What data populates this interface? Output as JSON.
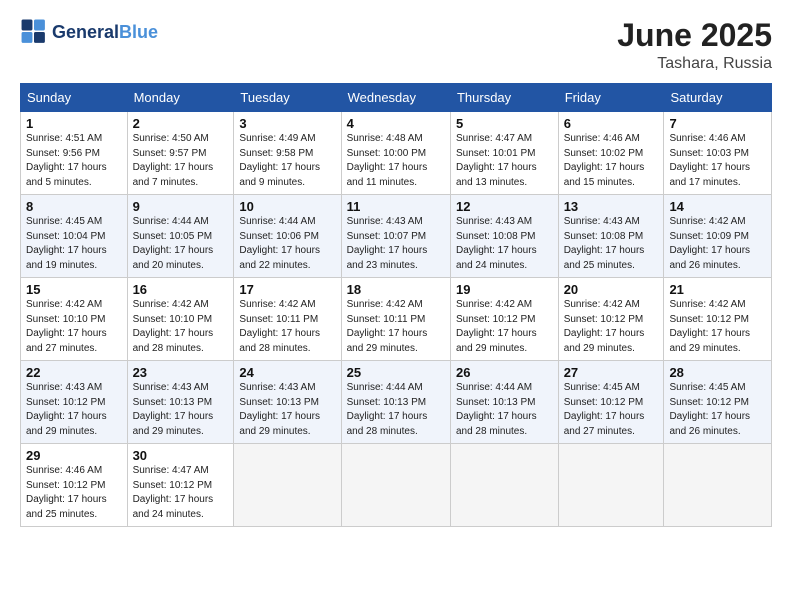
{
  "logo": {
    "text_general": "General",
    "text_blue": "Blue"
  },
  "title": "June 2025",
  "subtitle": "Tashara, Russia",
  "days_of_week": [
    "Sunday",
    "Monday",
    "Tuesday",
    "Wednesday",
    "Thursday",
    "Friday",
    "Saturday"
  ],
  "weeks": [
    [
      {
        "day": 1,
        "info": "Sunrise: 4:51 AM\nSunset: 9:56 PM\nDaylight: 17 hours\nand 5 minutes."
      },
      {
        "day": 2,
        "info": "Sunrise: 4:50 AM\nSunset: 9:57 PM\nDaylight: 17 hours\nand 7 minutes."
      },
      {
        "day": 3,
        "info": "Sunrise: 4:49 AM\nSunset: 9:58 PM\nDaylight: 17 hours\nand 9 minutes."
      },
      {
        "day": 4,
        "info": "Sunrise: 4:48 AM\nSunset: 10:00 PM\nDaylight: 17 hours\nand 11 minutes."
      },
      {
        "day": 5,
        "info": "Sunrise: 4:47 AM\nSunset: 10:01 PM\nDaylight: 17 hours\nand 13 minutes."
      },
      {
        "day": 6,
        "info": "Sunrise: 4:46 AM\nSunset: 10:02 PM\nDaylight: 17 hours\nand 15 minutes."
      },
      {
        "day": 7,
        "info": "Sunrise: 4:46 AM\nSunset: 10:03 PM\nDaylight: 17 hours\nand 17 minutes."
      }
    ],
    [
      {
        "day": 8,
        "info": "Sunrise: 4:45 AM\nSunset: 10:04 PM\nDaylight: 17 hours\nand 19 minutes."
      },
      {
        "day": 9,
        "info": "Sunrise: 4:44 AM\nSunset: 10:05 PM\nDaylight: 17 hours\nand 20 minutes."
      },
      {
        "day": 10,
        "info": "Sunrise: 4:44 AM\nSunset: 10:06 PM\nDaylight: 17 hours\nand 22 minutes."
      },
      {
        "day": 11,
        "info": "Sunrise: 4:43 AM\nSunset: 10:07 PM\nDaylight: 17 hours\nand 23 minutes."
      },
      {
        "day": 12,
        "info": "Sunrise: 4:43 AM\nSunset: 10:08 PM\nDaylight: 17 hours\nand 24 minutes."
      },
      {
        "day": 13,
        "info": "Sunrise: 4:43 AM\nSunset: 10:08 PM\nDaylight: 17 hours\nand 25 minutes."
      },
      {
        "day": 14,
        "info": "Sunrise: 4:42 AM\nSunset: 10:09 PM\nDaylight: 17 hours\nand 26 minutes."
      }
    ],
    [
      {
        "day": 15,
        "info": "Sunrise: 4:42 AM\nSunset: 10:10 PM\nDaylight: 17 hours\nand 27 minutes."
      },
      {
        "day": 16,
        "info": "Sunrise: 4:42 AM\nSunset: 10:10 PM\nDaylight: 17 hours\nand 28 minutes."
      },
      {
        "day": 17,
        "info": "Sunrise: 4:42 AM\nSunset: 10:11 PM\nDaylight: 17 hours\nand 28 minutes."
      },
      {
        "day": 18,
        "info": "Sunrise: 4:42 AM\nSunset: 10:11 PM\nDaylight: 17 hours\nand 29 minutes."
      },
      {
        "day": 19,
        "info": "Sunrise: 4:42 AM\nSunset: 10:12 PM\nDaylight: 17 hours\nand 29 minutes."
      },
      {
        "day": 20,
        "info": "Sunrise: 4:42 AM\nSunset: 10:12 PM\nDaylight: 17 hours\nand 29 minutes."
      },
      {
        "day": 21,
        "info": "Sunrise: 4:42 AM\nSunset: 10:12 PM\nDaylight: 17 hours\nand 29 minutes."
      }
    ],
    [
      {
        "day": 22,
        "info": "Sunrise: 4:43 AM\nSunset: 10:12 PM\nDaylight: 17 hours\nand 29 minutes."
      },
      {
        "day": 23,
        "info": "Sunrise: 4:43 AM\nSunset: 10:13 PM\nDaylight: 17 hours\nand 29 minutes."
      },
      {
        "day": 24,
        "info": "Sunrise: 4:43 AM\nSunset: 10:13 PM\nDaylight: 17 hours\nand 29 minutes."
      },
      {
        "day": 25,
        "info": "Sunrise: 4:44 AM\nSunset: 10:13 PM\nDaylight: 17 hours\nand 28 minutes."
      },
      {
        "day": 26,
        "info": "Sunrise: 4:44 AM\nSunset: 10:13 PM\nDaylight: 17 hours\nand 28 minutes."
      },
      {
        "day": 27,
        "info": "Sunrise: 4:45 AM\nSunset: 10:12 PM\nDaylight: 17 hours\nand 27 minutes."
      },
      {
        "day": 28,
        "info": "Sunrise: 4:45 AM\nSunset: 10:12 PM\nDaylight: 17 hours\nand 26 minutes."
      }
    ],
    [
      {
        "day": 29,
        "info": "Sunrise: 4:46 AM\nSunset: 10:12 PM\nDaylight: 17 hours\nand 25 minutes."
      },
      {
        "day": 30,
        "info": "Sunrise: 4:47 AM\nSunset: 10:12 PM\nDaylight: 17 hours\nand 24 minutes."
      },
      null,
      null,
      null,
      null,
      null
    ]
  ]
}
